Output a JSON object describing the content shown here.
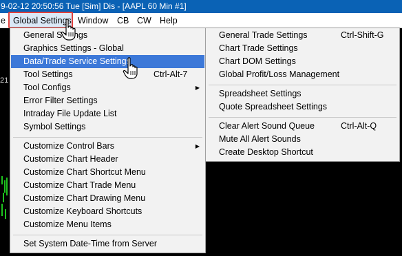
{
  "window": {
    "title": "9-02-12  20:50:56 Tue [Sim]  Dis - [AAPL  60 Min   #1]"
  },
  "menubar": {
    "items": [
      {
        "label": "e"
      },
      {
        "label": "Global Settings"
      },
      {
        "label": "Window"
      },
      {
        "label": "CB"
      },
      {
        "label": "CW"
      },
      {
        "label": "Help"
      }
    ]
  },
  "chart": {
    "side_label": "21"
  },
  "global_settings_menu": {
    "items": [
      {
        "label": "General Settings",
        "shortcut": "",
        "submenu": false
      },
      {
        "label": "Graphics Settings - Global",
        "shortcut": "",
        "submenu": false
      },
      {
        "label": "Data/Trade Service Settings",
        "shortcut": "",
        "submenu": false,
        "selected": true
      },
      {
        "label": "Tool Settings",
        "shortcut": "Ctrl-Alt-7",
        "submenu": false
      },
      {
        "label": "Tool Configs",
        "shortcut": "",
        "submenu": true
      },
      {
        "label": "Error Filter Settings",
        "shortcut": "",
        "submenu": false
      },
      {
        "label": "Intraday File Update List",
        "shortcut": "",
        "submenu": false
      },
      {
        "label": "Symbol Settings",
        "shortcut": "",
        "submenu": false
      },
      {
        "label": "Customize Control Bars",
        "shortcut": "",
        "submenu": true
      },
      {
        "label": "Customize Chart Header",
        "shortcut": "",
        "submenu": false
      },
      {
        "label": "Customize Chart Shortcut Menu",
        "shortcut": "",
        "submenu": false
      },
      {
        "label": "Customize Chart Trade Menu",
        "shortcut": "",
        "submenu": false
      },
      {
        "label": "Customize Chart Drawing Menu",
        "shortcut": "",
        "submenu": false
      },
      {
        "label": "Customize Keyboard Shortcuts",
        "shortcut": "",
        "submenu": false
      },
      {
        "label": "Customize Menu Items",
        "shortcut": "",
        "submenu": false
      },
      {
        "label": "Set System Date-Time from Server",
        "shortcut": "",
        "submenu": false
      }
    ]
  },
  "trade_settings_menu": {
    "items": [
      {
        "label": "General Trade Settings",
        "shortcut": "Ctrl-Shift-G"
      },
      {
        "label": "Chart Trade Settings",
        "shortcut": ""
      },
      {
        "label": "Chart DOM Settings",
        "shortcut": ""
      },
      {
        "label": "Global Profit/Loss Management",
        "shortcut": ""
      },
      {
        "label": "Spreadsheet Settings",
        "shortcut": ""
      },
      {
        "label": "Quote Spreadsheet Settings",
        "shortcut": ""
      },
      {
        "label": "Clear Alert Sound Queue",
        "shortcut": "Ctrl-Alt-Q"
      },
      {
        "label": "Mute All Alert Sounds",
        "shortcut": ""
      },
      {
        "label": "Create Desktop Shortcut",
        "shortcut": ""
      }
    ]
  },
  "colors": {
    "title_bar": "#0a62b5",
    "selection": "#3c78d8",
    "highlight_border": "#e0403c",
    "chart_background": "#000000",
    "candle_green": "#1ec31e"
  }
}
